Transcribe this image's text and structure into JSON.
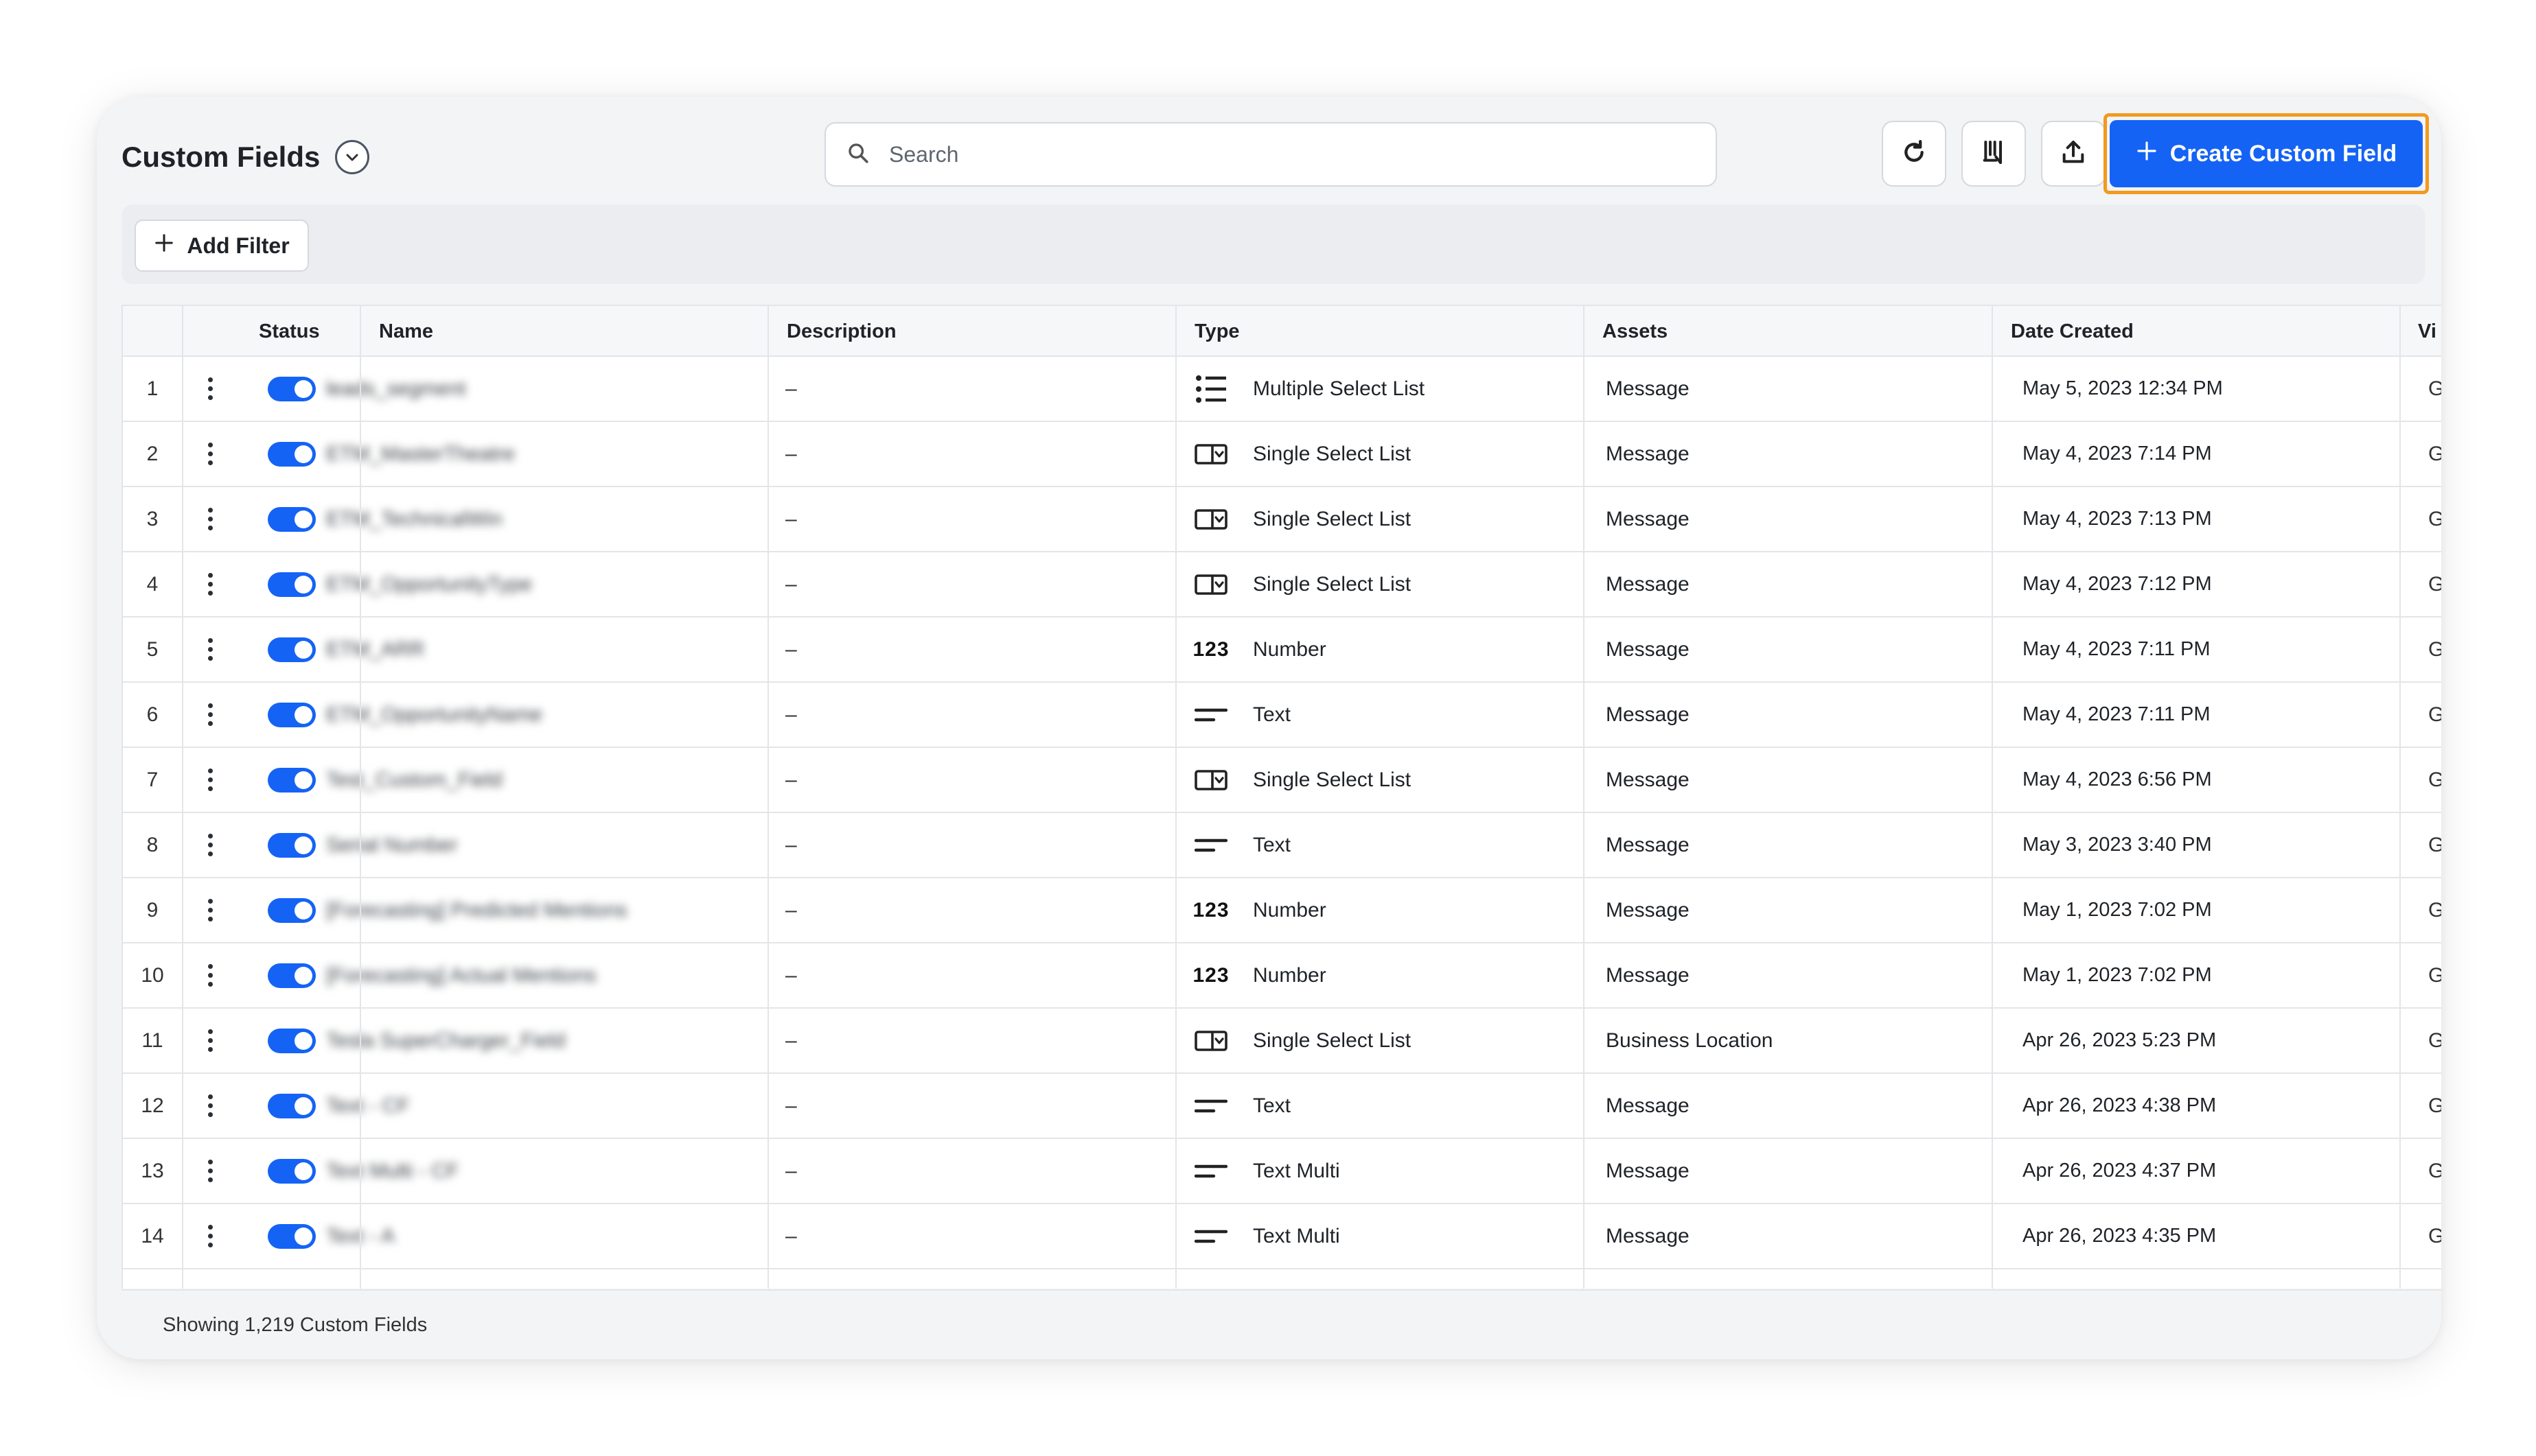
{
  "header": {
    "title": "Custom Fields",
    "search_placeholder": "Search",
    "create_label": "Create Custom Field",
    "add_filter_label": "Add Filter"
  },
  "icons": {
    "title_dropdown": "chevron-down-icon",
    "search": "search-icon",
    "refresh": "refresh-icon",
    "columns": "columns-icon",
    "export": "upload-icon",
    "more": "more-horizontal-icon",
    "create": "plus-icon",
    "add_filter": "plus-icon"
  },
  "colors": {
    "accent": "#1463f5",
    "highlight_outline": "#f29a1f"
  },
  "table": {
    "columns": [
      "Status",
      "Name",
      "Description",
      "Type",
      "Assets",
      "Date Created",
      "Vi"
    ],
    "rows": [
      {
        "num": "1",
        "name": "leads_segment",
        "description": "–",
        "type": "Multiple Select List",
        "type_icon": "list",
        "assets": "Message",
        "date": "May 5, 2023 12:34 PM",
        "vis": "Gl",
        "enabled": true
      },
      {
        "num": "2",
        "name": "ETM_MasterTheatre",
        "description": "–",
        "type": "Single Select List",
        "type_icon": "select",
        "assets": "Message",
        "date": "May 4, 2023 7:14 PM",
        "vis": "Gl",
        "enabled": true
      },
      {
        "num": "3",
        "name": "ETM_TechnicalWin",
        "description": "–",
        "type": "Single Select List",
        "type_icon": "select",
        "assets": "Message",
        "date": "May 4, 2023 7:13 PM",
        "vis": "Gl",
        "enabled": true
      },
      {
        "num": "4",
        "name": "ETM_OpportunityType",
        "description": "–",
        "type": "Single Select List",
        "type_icon": "select",
        "assets": "Message",
        "date": "May 4, 2023 7:12 PM",
        "vis": "Gl",
        "enabled": true
      },
      {
        "num": "5",
        "name": "ETM_ARR",
        "description": "–",
        "type": "Number",
        "type_icon": "number",
        "assets": "Message",
        "date": "May 4, 2023 7:11 PM",
        "vis": "Gl",
        "enabled": true
      },
      {
        "num": "6",
        "name": "ETM_OpportunityName",
        "description": "–",
        "type": "Text",
        "type_icon": "text",
        "assets": "Message",
        "date": "May 4, 2023 7:11 PM",
        "vis": "Gl",
        "enabled": true
      },
      {
        "num": "7",
        "name": "Test_Custom_Field",
        "description": "–",
        "type": "Single Select List",
        "type_icon": "select",
        "assets": "Message",
        "date": "May 4, 2023 6:56 PM",
        "vis": "Gl",
        "enabled": true
      },
      {
        "num": "8",
        "name": "Serial Number",
        "description": "–",
        "type": "Text",
        "type_icon": "text",
        "assets": "Message",
        "date": "May 3, 2023 3:40 PM",
        "vis": "Gl",
        "enabled": true
      },
      {
        "num": "9",
        "name": "[Forecasting] Predicted Mentions",
        "description": "–",
        "type": "Number",
        "type_icon": "number",
        "assets": "Message",
        "date": "May 1, 2023 7:02 PM",
        "vis": "Gl",
        "enabled": true
      },
      {
        "num": "10",
        "name": "[Forecasting] Actual Mentions",
        "description": "–",
        "type": "Number",
        "type_icon": "number",
        "assets": "Message",
        "date": "May 1, 2023 7:02 PM",
        "vis": "Gl",
        "enabled": true
      },
      {
        "num": "11",
        "name": "Tesla SuperCharger_Field",
        "description": "–",
        "type": "Single Select List",
        "type_icon": "select",
        "assets": "Business Location",
        "date": "Apr 26, 2023 5:23 PM",
        "vis": "Gl",
        "enabled": true
      },
      {
        "num": "12",
        "name": "Text - CF",
        "description": "–",
        "type": "Text",
        "type_icon": "text",
        "assets": "Message",
        "date": "Apr 26, 2023 4:38 PM",
        "vis": "Gl",
        "enabled": true
      },
      {
        "num": "13",
        "name": "Text Multi - CF",
        "description": "–",
        "type": "Text Multi",
        "type_icon": "text",
        "assets": "Message",
        "date": "Apr 26, 2023 4:37 PM",
        "vis": "Gl",
        "enabled": true
      },
      {
        "num": "14",
        "name": "Text - A",
        "description": "–",
        "type": "Text Multi",
        "type_icon": "text",
        "assets": "Message",
        "date": "Apr 26, 2023 4:35 PM",
        "vis": "Gl",
        "enabled": true
      }
    ]
  },
  "footer": {
    "status": "Showing 1,219 Custom Fields"
  }
}
